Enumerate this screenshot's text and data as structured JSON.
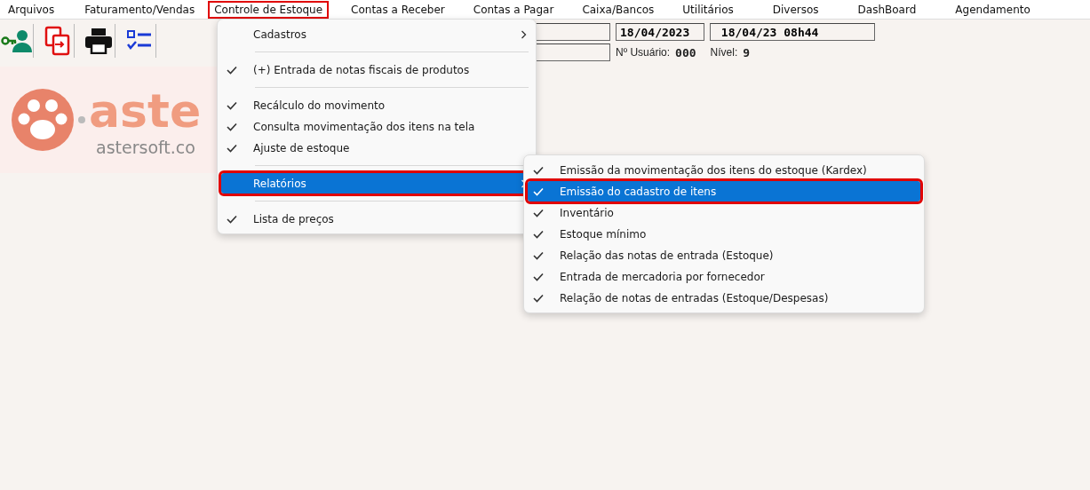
{
  "menubar": [
    {
      "label": "Arquivos",
      "outlined": false
    },
    {
      "label": "Faturamento/Vendas",
      "outlined": false
    },
    {
      "label": "Controle de Estoque",
      "outlined": true
    },
    {
      "label": "Contas a Receber",
      "outlined": false
    },
    {
      "label": "Contas a Pagar",
      "outlined": false
    },
    {
      "label": "Caixa/Bancos",
      "outlined": false
    },
    {
      "label": "Utilitários",
      "outlined": false
    },
    {
      "label": "Diversos",
      "outlined": false
    },
    {
      "label": "DashBoard",
      "outlined": false
    },
    {
      "label": "Agendamento",
      "outlined": false
    }
  ],
  "toolbar": [
    {
      "kind": "user"
    },
    {
      "kind": "copy"
    },
    {
      "kind": "print"
    },
    {
      "kind": "checklist"
    }
  ],
  "logo": {
    "name": "aste",
    "site": "astersoft.co"
  },
  "status": {
    "date": "18/04/2023",
    "datetime": "18/04/23 08h44",
    "user_label": "Nº Usuário:",
    "user": "000",
    "level_label": "Nível:",
    "level_value": "9"
  },
  "menu": [
    {
      "kind": "item",
      "label": "Cadastros",
      "checked": false,
      "submenu": true,
      "selected": false,
      "outlined": false
    },
    {
      "kind": "separator"
    },
    {
      "kind": "item",
      "label": "(+) Entrada de notas fiscais de produtos",
      "checked": true,
      "submenu": false,
      "selected": false,
      "outlined": false
    },
    {
      "kind": "separator"
    },
    {
      "kind": "item",
      "label": "Recálculo do movimento",
      "checked": true,
      "submenu": false,
      "selected": false,
      "outlined": false
    },
    {
      "kind": "item",
      "label": "Consulta movimentação dos itens na tela",
      "checked": true,
      "submenu": false,
      "selected": false,
      "outlined": false
    },
    {
      "kind": "item",
      "label": "Ajuste de estoque",
      "checked": true,
      "submenu": false,
      "selected": false,
      "outlined": false
    },
    {
      "kind": "separator"
    },
    {
      "kind": "item",
      "label": "Relatórios",
      "checked": false,
      "submenu": true,
      "selected": true,
      "outlined": true
    },
    {
      "kind": "separator"
    },
    {
      "kind": "item",
      "label": "Lista de preços",
      "checked": true,
      "submenu": false,
      "selected": false,
      "outlined": false
    }
  ],
  "submenu": [
    {
      "kind": "item",
      "label": "Emissão da movimentação dos itens do estoque (Kardex)",
      "checked": true,
      "submenu": false,
      "selected": false,
      "outlined": false
    },
    {
      "kind": "item",
      "label": "Emissão do cadastro de itens",
      "checked": true,
      "submenu": false,
      "selected": true,
      "outlined": true
    },
    {
      "kind": "item",
      "label": "Inventário",
      "checked": true,
      "submenu": false,
      "selected": false,
      "outlined": false
    },
    {
      "kind": "item",
      "label": "Estoque mínimo",
      "checked": true,
      "submenu": false,
      "selected": false,
      "outlined": false
    },
    {
      "kind": "item",
      "label": "Relação das notas de entrada (Estoque)",
      "checked": true,
      "submenu": false,
      "selected": false,
      "outlined": false
    },
    {
      "kind": "item",
      "label": "Entrada de mercadoria por fornecedor",
      "checked": true,
      "submenu": false,
      "selected": false,
      "outlined": false
    },
    {
      "kind": "item",
      "label": "Relação de notas de entradas (Estoque/Despesas)",
      "checked": true,
      "submenu": false,
      "selected": false,
      "outlined": false
    }
  ]
}
